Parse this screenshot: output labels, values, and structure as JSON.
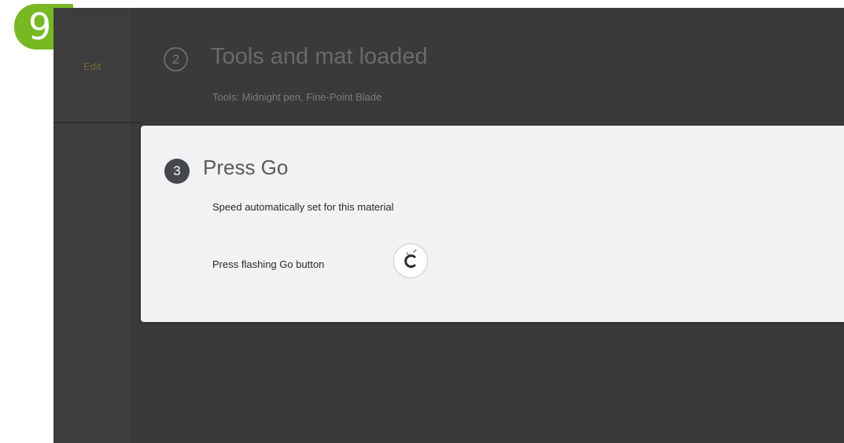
{
  "badge": {
    "number": "9",
    "color": "#78b823"
  },
  "sidebar": {
    "edit_label": "Edit"
  },
  "step2": {
    "number": "2",
    "title": "Tools and mat loaded",
    "subtitle": "Tools: Midnight pen, Fine-Point Blade"
  },
  "step3": {
    "number": "3",
    "title": "Press Go",
    "speed_text": "Speed automatically set for this material",
    "press_text": "Press flashing Go button",
    "go_icon": "cricut-go-icon"
  },
  "colors": {
    "background": "#3a3a3a",
    "card": "#f2f2f4",
    "step_number_bg": "#44474c"
  }
}
